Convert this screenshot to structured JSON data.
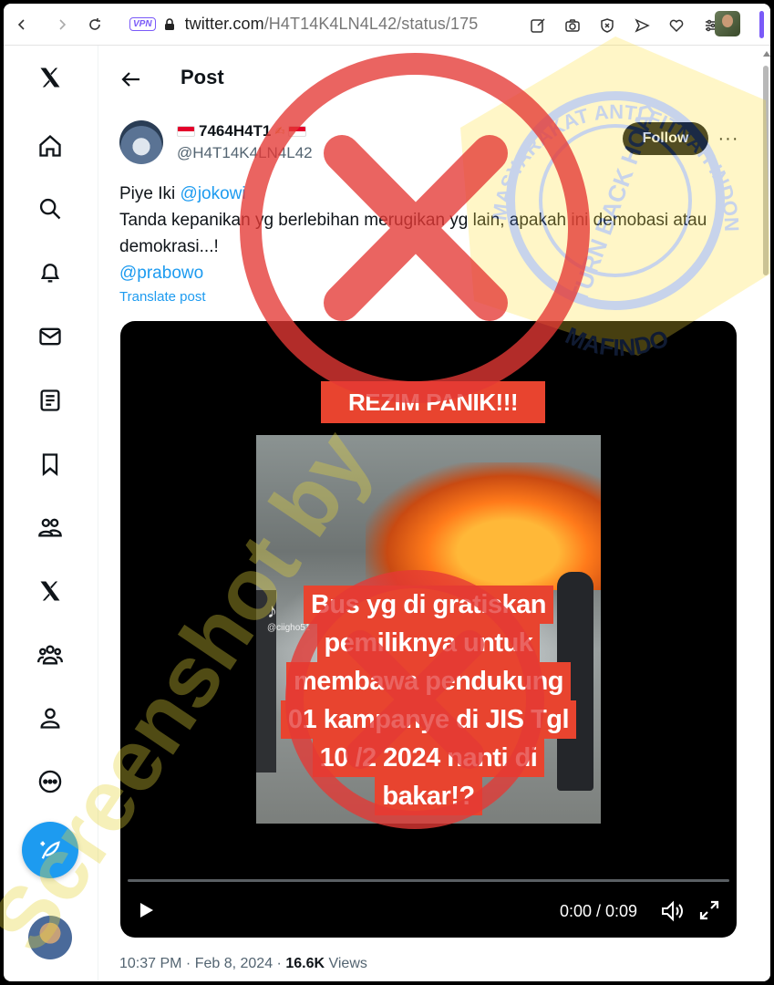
{
  "browser": {
    "vpn_label": "VPN",
    "url_host": "twitter.com",
    "url_path": "/H4T14K4LN4L42/status/175",
    "icons": [
      "back-icon",
      "forward-icon",
      "reload-icon",
      "edit-icon",
      "camera-icon",
      "shield-icon",
      "send-icon",
      "heart-icon",
      "menu-icon"
    ]
  },
  "nav": {
    "items": [
      "x-logo-icon",
      "home-icon",
      "search-icon",
      "bell-icon",
      "mail-icon",
      "list-icon",
      "bookmark-icon",
      "communities-icon",
      "premium-x-icon",
      "people-icon",
      "profile-icon",
      "more-circle-icon"
    ],
    "compose_icon": "compose-feather-icon"
  },
  "header": {
    "title": "Post"
  },
  "tweet": {
    "display_name": "7464H4T1",
    "handle": "@H4T14K4LN4L42",
    "follow_label": "Follow",
    "more_label": "···",
    "line1_prefix": "Piye Iki ",
    "mention1": "@jokowi",
    "line2": "Tanda kepanikan yg berlebihan merugikan yg lain, apakah ini demobasi atau demokrasi...!",
    "mention2": "@prabowo",
    "translate_label": "Translate post",
    "time": "10:37 PM",
    "sep1": " · ",
    "date": "Feb 8, 2024",
    "sep2": " · ",
    "views_count": "16.6K",
    "views_label": " Views"
  },
  "video": {
    "banner": "REZIM PANIK!!!",
    "caption_lines": [
      "Bus yg di gratiskan",
      "pemiliknya untuk",
      "membawa pendukung",
      "01 kampanye di JIS Tgl",
      "10 /2 2024 nanti di",
      "bakar!?"
    ],
    "tiktok_user": "@ciigho51",
    "time_display": "0:00 / 0:09",
    "progress": 0
  },
  "watermark": {
    "stamp_top": "MASYARAKAT ANTI FITNAH INDONESIA",
    "stamp_bottom": "MAFINDO",
    "stamp_center": "TURN BACK HOAX",
    "diagonal": "Screenshot by"
  },
  "colors": {
    "accent": "#1d9bf0",
    "text": "#0f1419",
    "muted": "#536471",
    "cross_red": "#e53935",
    "banner_red": "#e8442f"
  }
}
